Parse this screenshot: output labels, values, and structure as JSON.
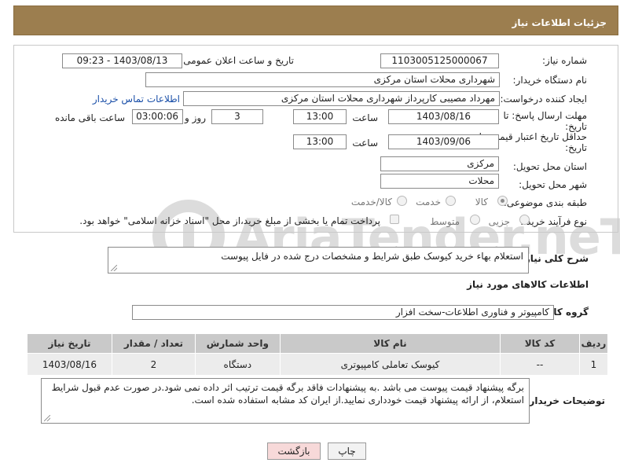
{
  "header": {
    "title": "جزئیات اطلاعات نیاز"
  },
  "form": {
    "need_number_label": "شماره نیاز:",
    "need_number": "1103005125000067",
    "announce_label": "تاریخ و ساعت اعلان عمومی:",
    "announce_value": "1403/08/13 - 09:23",
    "buyer_org_label": "نام دستگاه خریدار:",
    "buyer_org": "شهرداری محلات استان مرکزی",
    "creator_label": "ایجاد کننده درخواست:",
    "creator": "مهرداد مصیبی کارپرداز  شهرداری محلات استان مرکزی",
    "contact_link": "اطلاعات تماس خریدار",
    "deadline_label": "مهلت ارسال پاسخ: تا",
    "deadline_label2": "تاریخ:",
    "deadline_date": "1403/08/16",
    "time_label": "ساعت",
    "deadline_time": "13:00",
    "days_value": "3",
    "days_label": "روز و",
    "remaining_value": "03:00:06",
    "remaining_label": "ساعت باقی مانده",
    "validity_label": "حداقل تاریخ اعتبار قیمت: تا",
    "validity_label2": "تاریخ:",
    "validity_date": "1403/09/06",
    "validity_time": "13:00",
    "province_label": "استان محل تحویل:",
    "province": "مرکزی",
    "city_label": "شهر محل تحویل:",
    "city": "محلات",
    "category_label": "طبقه بندی موضوعی:",
    "category_options": [
      "کالا",
      "خدمت",
      "کالا/خدمت"
    ],
    "purchase_label": "نوع فرآیند خرید :",
    "purchase_options": [
      "جزیی",
      "متوسط"
    ],
    "treasury_note": "پرداخت تمام یا بخشی از مبلغ خرید،از محل \"اسناد خزانه اسلامی\" خواهد بود."
  },
  "description": {
    "label": "شرح کلی نیاز:",
    "text": "استعلام بهاء خرید کیوسک طبق شرایط و مشخصات درج شده در فایل پیوست"
  },
  "goods": {
    "section_title": "اطلاعات کالاهای مورد نیاز",
    "group_label": "گروه کالا:",
    "group_value": "کامپیوتر و فناوری اطلاعات-سخت افزار",
    "columns": [
      "ردیف",
      "کد کالا",
      "نام کالا",
      "واحد شمارش",
      "تعداد / مقدار",
      "تاریخ نیاز"
    ],
    "rows": [
      {
        "row": "1",
        "code": "--",
        "name": "کیوسک تعاملی کامپیوتری",
        "unit": "دستگاه",
        "qty": "2",
        "date": "1403/08/16"
      }
    ]
  },
  "buyer_notes": {
    "label": "توضیحات خریدار:",
    "text": "برگه پیشنهاد قیمت پیوست می باشد .به پیشنهادات فاقد برگه قیمت ترتیب اثر داده نمی شود.در صورت عدم قبول شرایط استعلام، از ارائه پیشنهاد قیمت خودداری نمایید.از ایران کد مشابه استفاده شده است."
  },
  "buttons": {
    "print": "چاپ",
    "back": "بازگشت"
  },
  "watermark": {
    "text": "AriaTender.neT"
  },
  "colors": {
    "header_bg": "#9c7e4f",
    "link": "#1a4fa8",
    "back_button_bg": "#f7d9d9"
  }
}
